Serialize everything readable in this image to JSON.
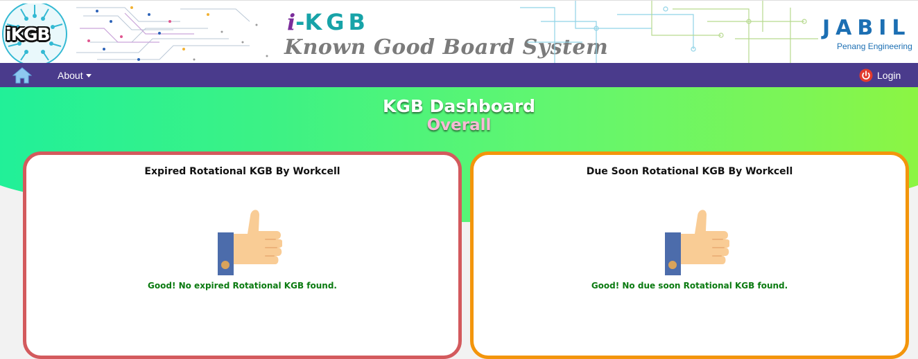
{
  "header": {
    "logo_text": "iKGB",
    "brand_i": "i",
    "brand_dash": "-",
    "brand_kgb": "KGB",
    "subtitle": "Known Good Board System",
    "company": "JABIL",
    "company_sub": "Penang Engineering"
  },
  "nav": {
    "home_icon": "home-icon",
    "about_label": "About",
    "login_label": "Login",
    "login_icon": "power-icon",
    "bar_color": "#4a3b8c"
  },
  "dashboard": {
    "title": "KGB Dashboard",
    "subtitle": "Overall"
  },
  "cards": [
    {
      "title": "Expired Rotational KGB By Workcell",
      "icon": "thumbs-up-icon",
      "message": "Good! No expired Rotational KGB found.",
      "border_color": "#d35a5d"
    },
    {
      "title": "Due Soon Rotational KGB By Workcell",
      "icon": "thumbs-up-icon",
      "message": "Good! No due soon Rotational KGB found.",
      "border_color": "#f3950b"
    }
  ],
  "colors": {
    "message_green": "#0a7a10",
    "hero_gradient_start": "#1ff09a",
    "hero_gradient_end": "#8ef540"
  }
}
